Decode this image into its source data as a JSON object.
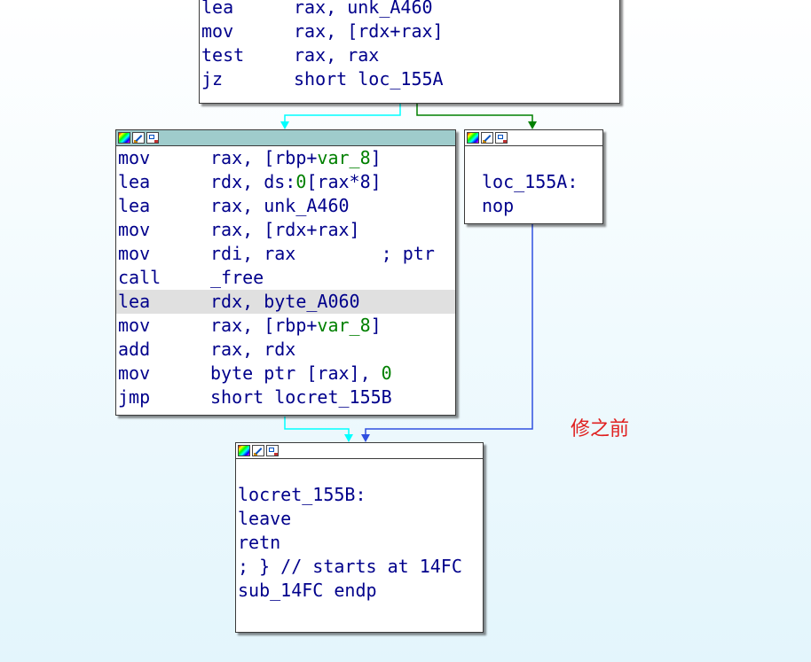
{
  "colors": {
    "edge_true": "#00ffff",
    "edge_false": "#008000",
    "edge_jump": "#3050e0",
    "code_text": "#00008b",
    "operand_highlight": "#008000",
    "caption": "#e02020",
    "selected_header": "#9fcccc"
  },
  "icons": [
    "node-color-icon",
    "node-rename-icon",
    "node-graph-icon"
  ],
  "top_block": {
    "lines": [
      {
        "mnemonic": "lea",
        "operands": "rax, unk_A460"
      },
      {
        "mnemonic": "mov",
        "operands": "rax, [rdx+rax]"
      },
      {
        "mnemonic": "test",
        "operands": "rax, rax"
      },
      {
        "mnemonic": "jz",
        "operands": "short loc_155A"
      }
    ]
  },
  "left_block": {
    "lines": [
      {
        "mnemonic": "mov",
        "pre": "rax, [rbp+",
        "hl": "var_8",
        "post": "]"
      },
      {
        "mnemonic": "lea",
        "pre": "rdx, ds:",
        "hl": "0",
        "post": "[rax*8]"
      },
      {
        "mnemonic": "lea",
        "pre": "rax, unk_A460",
        "hl": "",
        "post": ""
      },
      {
        "mnemonic": "mov",
        "pre": "rax, [rdx+rax]",
        "hl": "",
        "post": ""
      },
      {
        "mnemonic": "mov",
        "pre": "rdi, rax        ; ptr",
        "hl": "",
        "post": ""
      },
      {
        "mnemonic": "call",
        "pre": "_free",
        "hl": "",
        "post": ""
      },
      {
        "mnemonic": "lea",
        "pre": "rdx, byte_A060",
        "hl": "",
        "post": ""
      },
      {
        "mnemonic": "mov",
        "pre": "rax, [rbp+",
        "hl": "var_8",
        "post": "]"
      },
      {
        "mnemonic": "add",
        "pre": "rax, rdx",
        "hl": "",
        "post": ""
      },
      {
        "mnemonic": "mov",
        "pre": "byte ptr [rax], ",
        "hl": "0",
        "post": ""
      },
      {
        "mnemonic": "jmp",
        "pre": "short locret_155B",
        "hl": "",
        "post": ""
      }
    ]
  },
  "right_block": {
    "lines": [
      "",
      "loc_155A:",
      "nop"
    ]
  },
  "bottom_block": {
    "lines": [
      "",
      "locret_155B:",
      "leave",
      "retn",
      "; } // starts at 14FC",
      "sub_14FC endp"
    ]
  },
  "caption": "修之前"
}
